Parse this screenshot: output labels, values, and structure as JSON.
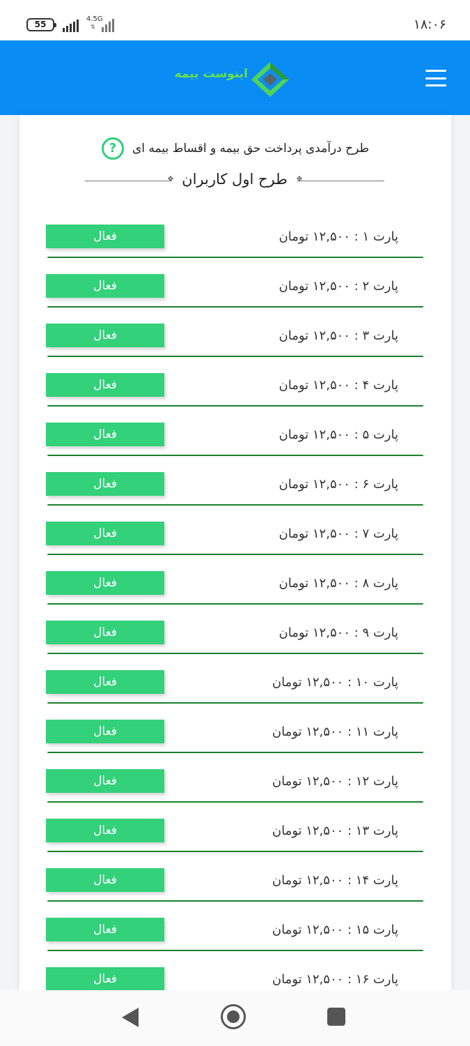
{
  "status_bar": {
    "battery": "55",
    "network": "4.5G",
    "time": "۱۸:۰۶"
  },
  "header": {
    "logo_text": "اینوست بیمه",
    "logo_icon": "diamond-logo-icon",
    "menu_icon": "hamburger-menu-icon",
    "background_color": "#0a8cf5"
  },
  "plan": {
    "description": "طرح درآمدی پرداخت حق بیمه و اقساط بیمه ای",
    "help_icon_glyph": "?",
    "title": "طرح اول کاربران"
  },
  "parts": [
    {
      "label": "پارت ۱ : ۱۲,۵۰۰ تومان",
      "status": "فعال"
    },
    {
      "label": "پارت ۲ : ۱۲,۵۰۰ تومان",
      "status": "فعال"
    },
    {
      "label": "پارت ۳ : ۱۲,۵۰۰ تومان",
      "status": "فعال"
    },
    {
      "label": "پارت ۴ : ۱۲,۵۰۰ تومان",
      "status": "فعال"
    },
    {
      "label": "پارت ۵ : ۱۲,۵۰۰ تومان",
      "status": "فعال"
    },
    {
      "label": "پارت ۶ : ۱۲,۵۰۰ تومان",
      "status": "فعال"
    },
    {
      "label": "پارت ۷ : ۱۲,۵۰۰ تومان",
      "status": "فعال"
    },
    {
      "label": "پارت ۸ : ۱۲,۵۰۰ تومان",
      "status": "فعال"
    },
    {
      "label": "پارت ۹ : ۱۲,۵۰۰ تومان",
      "status": "فعال"
    },
    {
      "label": "پارت ۱۰ : ۱۲,۵۰۰ تومان",
      "status": "فعال"
    },
    {
      "label": "پارت ۱۱ : ۱۲,۵۰۰ تومان",
      "status": "فعال"
    },
    {
      "label": "پارت ۱۲ : ۱۲,۵۰۰ تومان",
      "status": "فعال"
    },
    {
      "label": "پارت ۱۳ : ۱۲,۵۰۰ تومان",
      "status": "فعال"
    },
    {
      "label": "پارت ۱۴ : ۱۲,۵۰۰ تومان",
      "status": "فعال"
    },
    {
      "label": "پارت ۱۵ : ۱۲,۵۰۰ تومان",
      "status": "فعال"
    },
    {
      "label": "پارت ۱۶ : ۱۲,۵۰۰ تومان",
      "status": "فعال"
    }
  ],
  "colors": {
    "status_active": "#33d17a",
    "row_line": "#1b7f2b",
    "help_icon": "#2dcf7a"
  },
  "nav_bar": {
    "back_icon": "triangle-back-icon",
    "home_icon": "circle-home-icon",
    "recents_icon": "square-recents-icon"
  }
}
